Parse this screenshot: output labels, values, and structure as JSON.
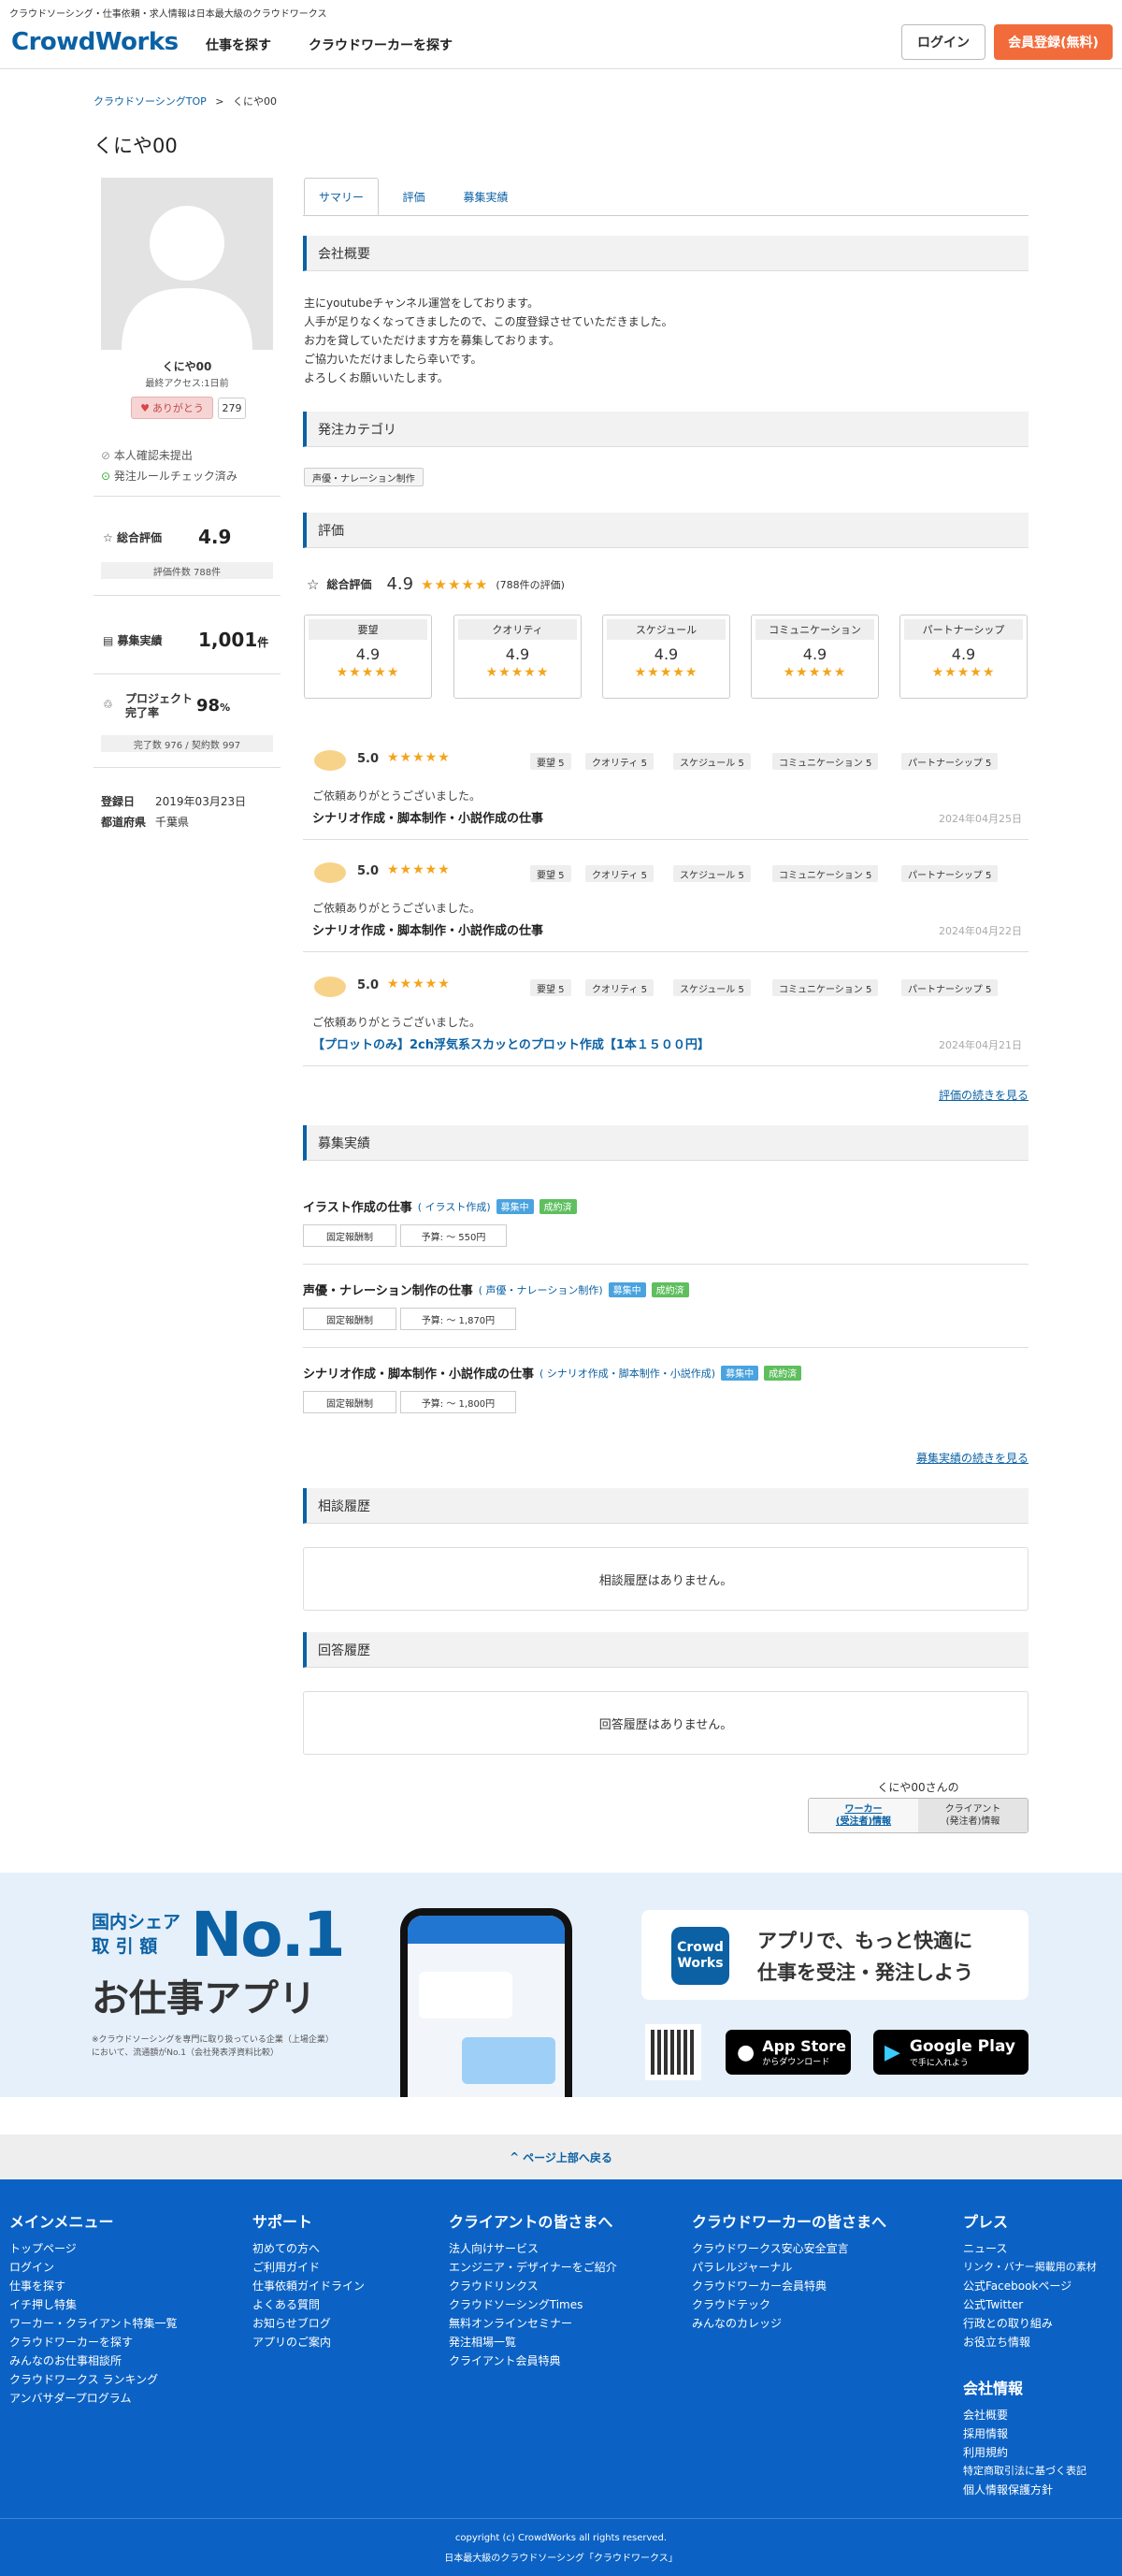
{
  "topline": "クラウドソーシング・仕事依頼・求人情報は日本最大級のクラウドワークス",
  "header": {
    "logo": "CrowdWorks",
    "nav1": "仕事を探す",
    "nav2": "クラウドワーカーを探す",
    "login": "ログイン",
    "register": "会員登録(無料)"
  },
  "breadcrumb": {
    "top": "クラウドソーシングTOP",
    "sep": ">",
    "current": "くにや00"
  },
  "profile": {
    "name": "くにや00",
    "last_access": "最終アクセス:1日前",
    "thanks": "ありがとう",
    "thanks_count": "279",
    "check1": "本人確認未提出",
    "check2": "発注ルールチェック済み",
    "rating_label": "総合評価",
    "rating_value": "4.9",
    "rating_count": "評価件数 788件",
    "recruit_label": "募集実績",
    "recruit_value": "1,001",
    "recruit_unit": "件",
    "completion_label1": "プロジェクト",
    "completion_label2": "完了率",
    "completion_value": "98",
    "completion_unit": "%",
    "completion_sub": "完了数 976 / 契約数 997",
    "reg_label": "登録日",
    "reg_value": "2019年03月23日",
    "pref_label": "都道府県",
    "pref_value": "千葉県"
  },
  "tabs": [
    "サマリー",
    "評価",
    "募集実績"
  ],
  "sections": {
    "company": "会社概要",
    "category": "発注カテゴリ",
    "rating": "評価",
    "recruit": "募集実績",
    "consult": "相談履歴",
    "answer": "回答履歴"
  },
  "description": [
    "主にyoutubeチャンネル運営をしております。",
    "人手が足りなくなってきましたので、この度登録させていただきました。",
    "お力を貸していただけます方を募集しております。",
    "ご協力いただけましたら幸いです。",
    "よろしくお願いいたします。"
  ],
  "category_tag": "声優・ナレーション制作",
  "overall": {
    "label": "総合評価",
    "value": "4.9",
    "stars": "★★★★★",
    "count": "(788件の評価)"
  },
  "rate_boxes": [
    {
      "label": "要望",
      "value": "4.9"
    },
    {
      "label": "クオリティ",
      "value": "4.9"
    },
    {
      "label": "スケジュール",
      "value": "4.9"
    },
    {
      "label": "コミュニケーション",
      "value": "4.9"
    },
    {
      "label": "パートナーシップ",
      "value": "4.9"
    }
  ],
  "star_row": "★★★★★",
  "reviews": [
    {
      "score": "5.0",
      "chips": [
        "要望 5",
        "クオリティ 5",
        "スケジュール 5",
        "コミュニケーション 5",
        "パートナーシップ 5"
      ],
      "comment": "ご依頼ありがとうございました。",
      "title": "シナリオ作成・脚本制作・小説作成の仕事",
      "date": "2024年04月25日"
    },
    {
      "score": "5.0",
      "chips": [
        "要望 5",
        "クオリティ 5",
        "スケジュール 5",
        "コミュニケーション 5",
        "パートナーシップ 5"
      ],
      "comment": "ご依頼ありがとうございました。",
      "title": "シナリオ作成・脚本制作・小説作成の仕事",
      "date": "2024年04月22日"
    },
    {
      "score": "5.0",
      "chips": [
        "要望 5",
        "クオリティ 5",
        "スケジュール 5",
        "コミュニケーション 5",
        "パートナーシップ 5"
      ],
      "comment": "ご依頼ありがとうございました。",
      "title": "【プロットのみ】2ch浮気系スカッとのプロット作成【1本１５００円】",
      "date": "2024年04月21日"
    }
  ],
  "more_reviews": "評価の続きを見る",
  "jobs": [
    {
      "title": "イラスト作成の仕事",
      "category": "( イラスト作成)",
      "badge1": "募集中",
      "badge2": "成約済",
      "type": "固定報酬制",
      "budget": "予算: 〜 550円"
    },
    {
      "title": "声優・ナレーション制作の仕事",
      "category": "( 声優・ナレーション制作)",
      "badge1": "募集中",
      "badge2": "成約済",
      "type": "固定報酬制",
      "budget": "予算: 〜 1,870円"
    },
    {
      "title": "シナリオ作成・脚本制作・小説作成の仕事",
      "category": "( シナリオ作成・脚本制作・小説作成)",
      "badge1": "募集中",
      "badge2": "成約済",
      "type": "固定報酬制",
      "budget": "予算: 〜 1,800円"
    }
  ],
  "more_jobs": "募集実績の続きを見る",
  "consult_empty": "相談履歴はありません。",
  "answer_empty": "回答履歴はありません。",
  "switch": {
    "title": "くにや00さんの",
    "worker": "ワーカー\n(受注者)情報",
    "client": "クライアント\n(発注者)情報"
  },
  "promo": {
    "share1": "国内シェア",
    "share2": "取 引 額",
    "no1": "No.1",
    "app": "お仕事アプリ",
    "note": "※クラウドソーシングを専門に取り扱っている企業（上場企業）において、流通額がNo.1（会社発表浮資料比較）",
    "bubble1": "アプリで、もっと快適に",
    "bubble2": "仕事を受注・発注しよう",
    "icon_text": "Crowd Works",
    "appstore_small": "",
    "appstore": "App Store",
    "appstore_sub": "からダウンロード",
    "gplay": "Google Play",
    "gplay_sub": "で手に入れよう"
  },
  "pagetop": "ページ上部へ戻る",
  "footer": {
    "cols": [
      {
        "title": "メインメニュー",
        "items": [
          "トップページ",
          "ログイン",
          "仕事を探す",
          "イチ押し特集",
          "ワーカー・クライアント特集一覧",
          "クラウドワーカーを探す",
          "みんなのお仕事相談所",
          "クラウドワークス ランキング",
          "アンバサダープログラム"
        ]
      },
      {
        "title": "サポート",
        "items": [
          "初めての方へ",
          "ご利用ガイド",
          "仕事依頼ガイドライン",
          "よくある質問",
          "お知らせブログ",
          "アプリのご案内"
        ]
      },
      {
        "title": "クライアントの皆さまへ",
        "items": [
          "法人向けサービス",
          "エンジニア・デザイナーをご紹介",
          "クラウドリンクス",
          "クラウドソーシングTimes",
          "無料オンラインセミナー",
          "発注相場一覧",
          "クライアント会員特典"
        ]
      },
      {
        "title": "クラウドワーカーの皆さまへ",
        "items": [
          "クラウドワークス安心安全宣言",
          "パラレルジャーナル",
          "クラウドワーカー会員特典",
          "クラウドテック",
          "みんなのカレッジ"
        ]
      },
      {
        "title": "プレス",
        "items": [
          "ニュース",
          "リンク・バナー掲載用の素材",
          "公式Facebookページ",
          "公式Twitter",
          "行政との取り組み",
          "お役立ち情報"
        ]
      }
    ],
    "company_title": "会社情報",
    "company_items": [
      "会社概要",
      "採用情報",
      "利用規約",
      "特定商取引法に基づく表記",
      "個人情報保護方針"
    ],
    "copyright": "copyright (c) CrowdWorks all rights reserved.",
    "tagline": "日本最大級のクラウドソーシング「クラウドワークス」"
  }
}
